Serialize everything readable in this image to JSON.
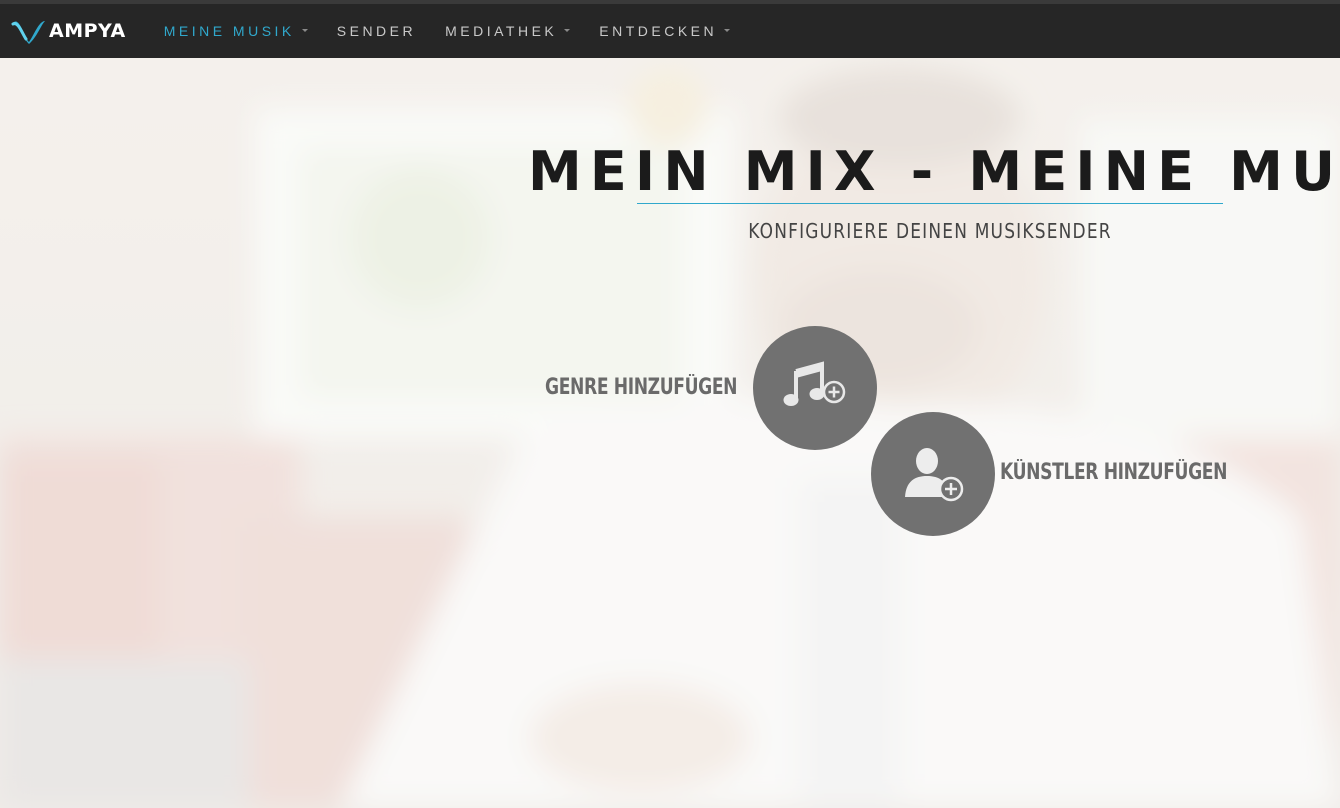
{
  "app": {
    "logo_text": "AMPYA"
  },
  "nav": {
    "items": [
      {
        "label": "MEINE MUSIK",
        "active": true,
        "has_dropdown": true
      },
      {
        "label": "SENDER",
        "active": false,
        "has_dropdown": false
      },
      {
        "label": "MEDIATHEK",
        "active": false,
        "has_dropdown": true
      },
      {
        "label": "ENTDECKEN",
        "active": false,
        "has_dropdown": true
      }
    ]
  },
  "hero": {
    "title": "MEIN MIX - MEINE MUSIK",
    "subtitle": "KONFIGURIERE DEINEN MUSIKSENDER",
    "actions": [
      {
        "label": "GENRE HINZUFÜGEN",
        "icon": "music-note-add-icon"
      },
      {
        "label": "KÜNSTLER HINZUFÜGEN",
        "icon": "user-add-icon"
      }
    ]
  },
  "colors": {
    "accent": "#30a8cc",
    "navbar_bg": "#262626",
    "circle_button": "#717171"
  }
}
